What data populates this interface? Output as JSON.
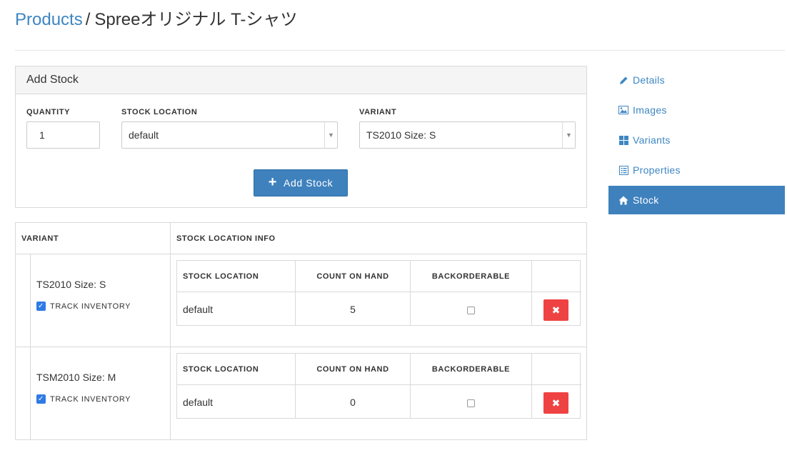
{
  "breadcrumb": {
    "parent": "Products",
    "separator": "/",
    "current": "Spreeオリジナル T-シャツ"
  },
  "add_stock": {
    "title": "Add Stock",
    "quantity_label": "QUANTITY",
    "quantity_value": "1",
    "location_label": "STOCK LOCATION",
    "location_value": "default",
    "variant_label": "VARIANT",
    "variant_value": "TS2010 Size: S",
    "button_label": "Add Stock"
  },
  "stock_table": {
    "col_variant": "VARIANT",
    "col_info": "STOCK LOCATION INFO",
    "inner_headers": {
      "location": "STOCK LOCATION",
      "count": "COUNT ON HAND",
      "backorderable": "BACKORDERABLE"
    },
    "rows": [
      {
        "variant": "TS2010 Size: S",
        "track_label": "TRACK INVENTORY",
        "track_checked": true,
        "location": "default",
        "count": "5",
        "backorderable": false
      },
      {
        "variant": "TSM2010 Size: M",
        "track_label": "TRACK INVENTORY",
        "track_checked": true,
        "location": "default",
        "count": "0",
        "backorderable": false
      }
    ]
  },
  "sidebar": {
    "items": [
      {
        "label": "Details",
        "icon": "pencil-icon",
        "active": false
      },
      {
        "label": "Images",
        "icon": "image-icon",
        "active": false
      },
      {
        "label": "Variants",
        "icon": "grid-icon",
        "active": false
      },
      {
        "label": "Properties",
        "icon": "list-icon",
        "active": false
      },
      {
        "label": "Stock",
        "icon": "home-icon",
        "active": true
      }
    ]
  },
  "colors": {
    "link": "#3e86c2",
    "primary": "#3e81bd",
    "danger": "#ef4343",
    "checkbox": "#2f7ae5"
  }
}
